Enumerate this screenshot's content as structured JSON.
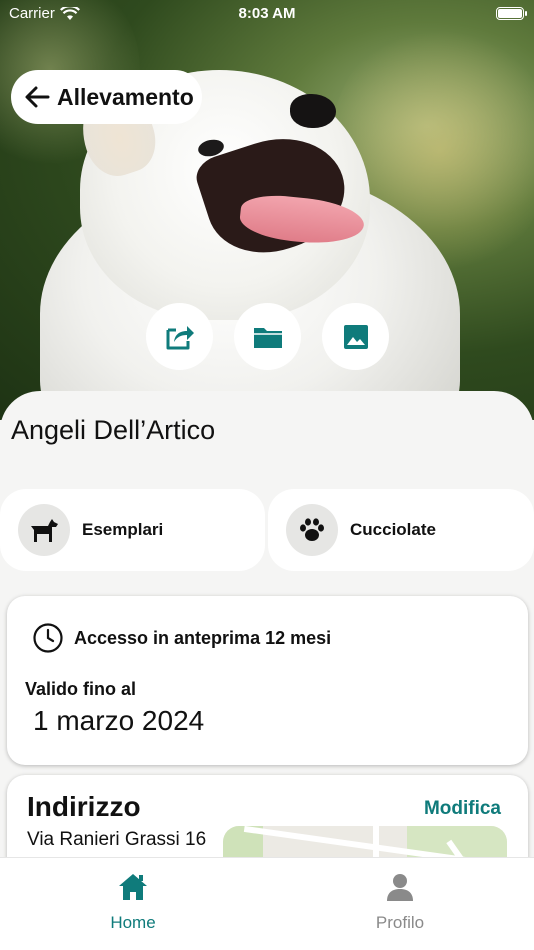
{
  "status": {
    "carrier": "Carrier",
    "time": "8:03 AM"
  },
  "header": {
    "back_label": "Allevamento"
  },
  "actions": [
    {
      "icon": "share-icon"
    },
    {
      "icon": "folder-icon"
    },
    {
      "icon": "image-icon"
    }
  ],
  "kennel": {
    "name": "Angeli Dell’Artico"
  },
  "quick_links": [
    {
      "label": "Esemplari",
      "icon": "dog-icon"
    },
    {
      "label": "Cucciolate",
      "icon": "paw-icon"
    }
  ],
  "access": {
    "title": "Accesso in anteprima 12 mesi",
    "valid_label": "Valido fino al",
    "valid_date": "1 marzo 2024"
  },
  "address": {
    "title": "Indirizzo",
    "edit_label": "Modifica",
    "street": "Via Ranieri Grassi 16"
  },
  "tabs": [
    {
      "label": "Home",
      "icon": "home-icon",
      "active": true
    },
    {
      "label": "Profilo",
      "icon": "profile-icon",
      "active": false
    }
  ],
  "colors": {
    "accent": "#0f7b7b",
    "inactive": "#8a8a8a"
  }
}
